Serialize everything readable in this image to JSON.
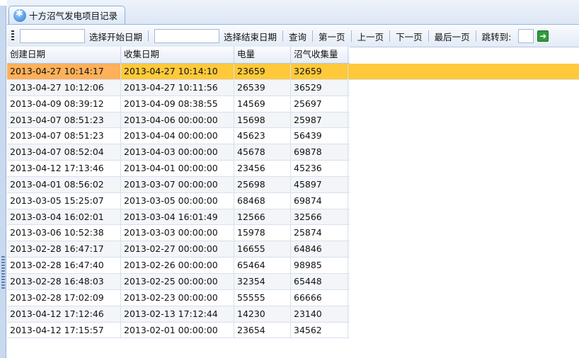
{
  "tab": {
    "icon": "app-icon",
    "label": "十方沼气发电项目记录"
  },
  "toolbar": {
    "start_date_value": "",
    "start_date_label": "选择开始日期",
    "end_date_value": "",
    "end_date_label": "选择结束日期",
    "query": "查询",
    "first": "第一页",
    "prev": "上一页",
    "next": "下一页",
    "last": "最后一页",
    "jump_label": "跳转到:",
    "jump_value": "",
    "go_icon": "arrow-right-icon"
  },
  "grid": {
    "columns": [
      "创建日期",
      "收集日期",
      "电量",
      "沼气收集量"
    ],
    "rows": [
      [
        "2013-04-27 10:14:17",
        "2013-04-27 10:14:10",
        "23659",
        "32659"
      ],
      [
        "2013-04-27 10:12:06",
        "2013-04-27 10:11:56",
        "26539",
        "36529"
      ],
      [
        "2013-04-09 08:39:12",
        "2013-04-09 08:38:55",
        "14569",
        "25697"
      ],
      [
        "2013-04-07 08:51:23",
        "2013-04-06 00:00:00",
        "15698",
        "25987"
      ],
      [
        "2013-04-07 08:51:23",
        "2013-04-04 00:00:00",
        "45623",
        "56439"
      ],
      [
        "2013-04-07 08:52:04",
        "2013-04-03 00:00:00",
        "45678",
        "69878"
      ],
      [
        "2013-04-12 17:13:46",
        "2013-04-01 00:00:00",
        "23456",
        "45236"
      ],
      [
        "2013-04-01 08:56:02",
        "2013-03-07 00:00:00",
        "25698",
        "45897"
      ],
      [
        "2013-03-05 15:25:07",
        "2013-03-05 00:00:00",
        "68468",
        "69874"
      ],
      [
        "2013-03-04 16:02:01",
        "2013-03-04 16:01:49",
        "12566",
        "32566"
      ],
      [
        "2013-03-06 10:52:38",
        "2013-03-03 00:00:00",
        "15978",
        "25874"
      ],
      [
        "2013-02-28 16:47:17",
        "2013-02-27 00:00:00",
        "16655",
        "64846"
      ],
      [
        "2013-02-28 16:47:40",
        "2013-02-26 00:00:00",
        "65464",
        "98985"
      ],
      [
        "2013-02-28 16:48:03",
        "2013-02-25 00:00:00",
        "32354",
        "65448"
      ],
      [
        "2013-02-28 17:02:09",
        "2013-02-23 00:00:00",
        "55555",
        "66666"
      ],
      [
        "2013-04-12 17:12:46",
        "2013-02-13 17:12:44",
        "14230",
        "23140"
      ],
      [
        "2013-04-12 17:15:57",
        "2013-02-01 00:00:00",
        "23654",
        "34562"
      ]
    ],
    "selected_row": 0
  },
  "colors": {
    "selected_row": "#ffc93a",
    "selected_cell": "#ffb05a",
    "accent": "#99b4d8"
  }
}
